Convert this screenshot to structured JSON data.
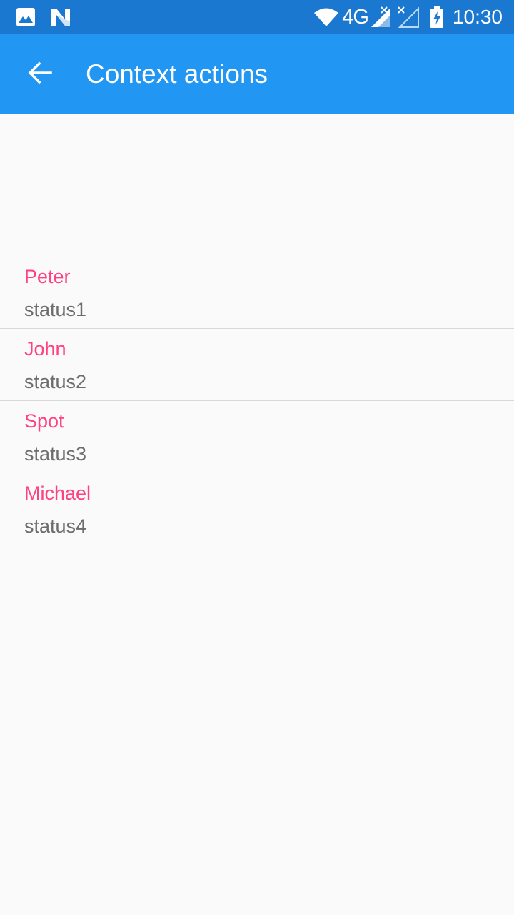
{
  "status_bar": {
    "left_icons": [
      "image-icon",
      "n-notification-icon"
    ],
    "network_label": "4G",
    "right_icons": [
      "wifi-icon",
      "signal-icon",
      "signal-empty-icon",
      "battery-charging-icon"
    ],
    "time": "10:30",
    "background": "#1b78d0"
  },
  "app_bar": {
    "back_icon": "arrow-back-icon",
    "title": "Context actions",
    "background": "#2196f3"
  },
  "list": {
    "name_color": "#ff4081",
    "status_color": "#6d6d6d",
    "items": [
      {
        "name": "Peter",
        "status": "status1"
      },
      {
        "name": "John",
        "status": "status2"
      },
      {
        "name": "Spot",
        "status": "status3"
      },
      {
        "name": "Michael",
        "status": "status4"
      }
    ]
  }
}
